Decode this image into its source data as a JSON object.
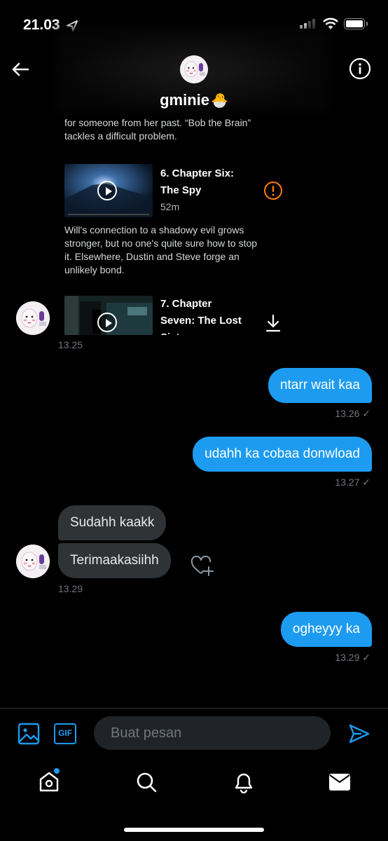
{
  "status_bar": {
    "time": "21.03"
  },
  "header": {
    "name": "gminie",
    "name_emoji": "🐣"
  },
  "media_card": {
    "prev_description": "for someone from her past. “Bob the Brain” tackles a difficult problem.",
    "episode6": {
      "title_line1": "6. Chapter Six:",
      "title_line2": "The Spy",
      "duration": "52m",
      "description": "Will's connection to a shadowy evil grows stronger, but no one's quite sure how to stop it. Elsewhere, Dustin and Steve forge an unlikely bond."
    },
    "episode7": {
      "title_line1": "7. Chapter",
      "title_line2": "Seven: The Lost",
      "title_line3_partial": "Sist"
    }
  },
  "messages": {
    "card_time": "13.25",
    "m1": {
      "text": "ntarr wait kaa",
      "time": "13.26 ✓"
    },
    "m2": {
      "text": "udahh ka cobaa donwload",
      "time": "13.27 ✓"
    },
    "m3": {
      "text": "Sudahh kaakk"
    },
    "m4": {
      "text": "Terimaakasiihh",
      "time": "13.29"
    },
    "m5": {
      "text": "ogheyyy ka",
      "time": "13.29 ✓"
    }
  },
  "composer": {
    "placeholder": "Buat pesan",
    "gif_label": "GIF"
  },
  "colors": {
    "accent": "#1d9bf0",
    "warning": "#ff7a00",
    "background": "#000000",
    "incoming_bubble": "#2f3336"
  }
}
